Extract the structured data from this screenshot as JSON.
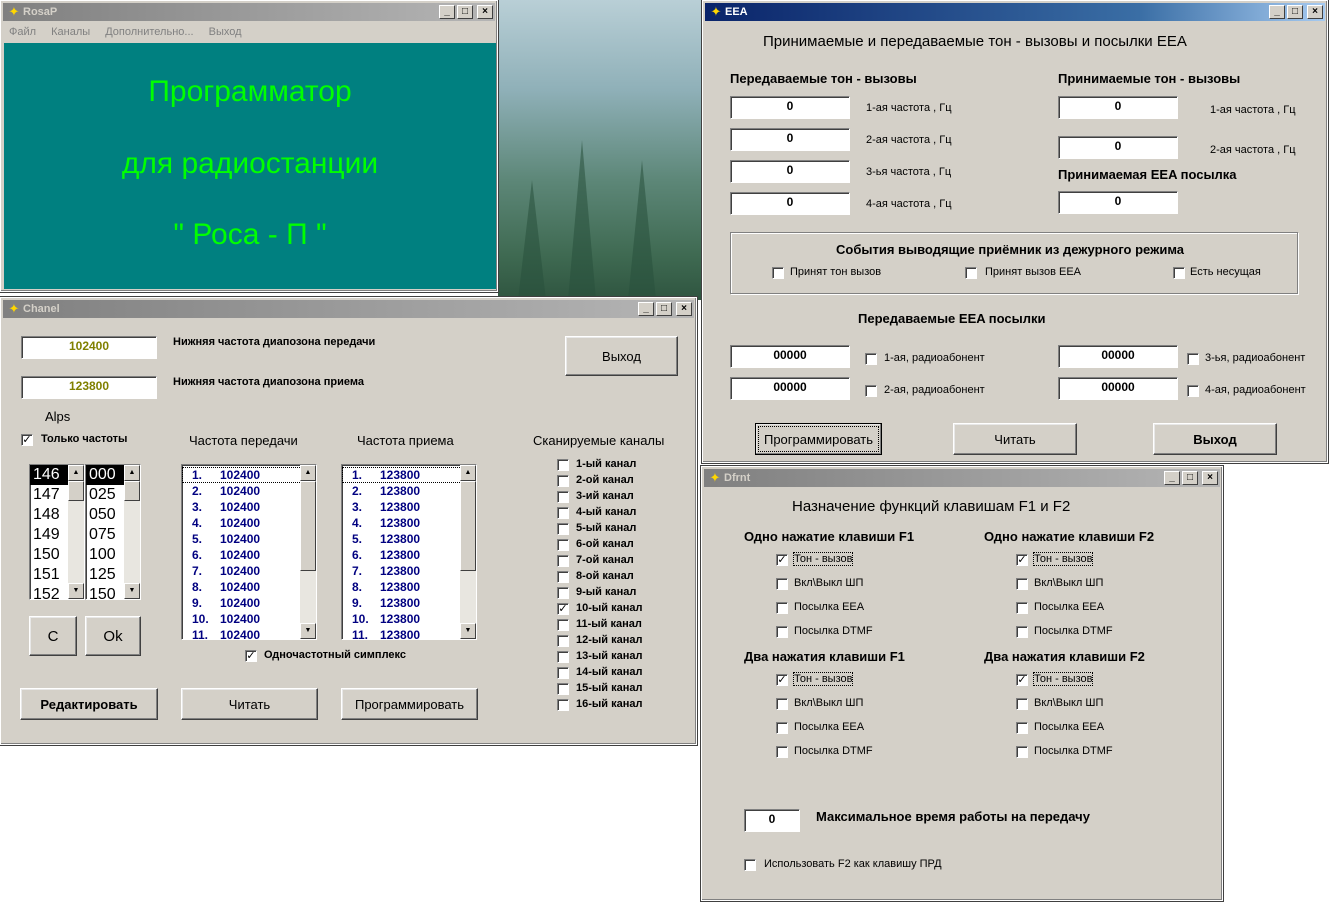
{
  "rosap": {
    "title": "RosaP",
    "menu": [
      "Файл",
      "Каналы",
      "Дополнительно...",
      "Выход"
    ],
    "banner": [
      "Программатор",
      "для  радиостанции",
      "\" Роса -  П \""
    ]
  },
  "chanel": {
    "title": "Chanel",
    "tx_low_value": "102400",
    "tx_low_label": "Нижняя  частота  диапозона  передачи",
    "rx_low_value": "123800",
    "rx_low_label": "Нижняя  частота  диапозона  приема",
    "exit_label": "Выход",
    "alps_label": "Alps",
    "only_freq_label": "Только частоты",
    "tx_freq_header": "Частота передачи",
    "rx_freq_header": "Частота приема",
    "scan_header": "Сканируемые  каналы",
    "mhz_list": [
      "146",
      "147",
      "148",
      "149",
      "150",
      "151",
      "152"
    ],
    "khz_list": [
      "000",
      "025",
      "050",
      "075",
      "100",
      "125",
      "150"
    ],
    "tx_list": [
      {
        "n": "1.",
        "v": "102400"
      },
      {
        "n": "2.",
        "v": "102400"
      },
      {
        "n": "3.",
        "v": "102400"
      },
      {
        "n": "4.",
        "v": "102400"
      },
      {
        "n": "5.",
        "v": "102400"
      },
      {
        "n": "6.",
        "v": "102400"
      },
      {
        "n": "7.",
        "v": "102400"
      },
      {
        "n": "8.",
        "v": "102400"
      },
      {
        "n": "9.",
        "v": "102400"
      },
      {
        "n": "10.",
        "v": "102400"
      },
      {
        "n": "11.",
        "v": "102400"
      }
    ],
    "rx_list": [
      {
        "n": "1.",
        "v": "123800"
      },
      {
        "n": "2.",
        "v": "123800"
      },
      {
        "n": "3.",
        "v": "123800"
      },
      {
        "n": "4.",
        "v": "123800"
      },
      {
        "n": "5.",
        "v": "123800"
      },
      {
        "n": "6.",
        "v": "123800"
      },
      {
        "n": "7.",
        "v": "123800"
      },
      {
        "n": "8.",
        "v": "123800"
      },
      {
        "n": "9.",
        "v": "123800"
      },
      {
        "n": "10.",
        "v": "123800"
      },
      {
        "n": "11.",
        "v": "123800"
      }
    ],
    "scan_channels": [
      {
        "label": "1-ый канал",
        "checked": false
      },
      {
        "label": "2-ой канал",
        "checked": false
      },
      {
        "label": "3-ий канал",
        "checked": false
      },
      {
        "label": "4-ый канал",
        "checked": false
      },
      {
        "label": "5-ый канал",
        "checked": false
      },
      {
        "label": "6-ой канал",
        "checked": false
      },
      {
        "label": "7-ой канал",
        "checked": false
      },
      {
        "label": "8-ой канал",
        "checked": false
      },
      {
        "label": "9-ый канал",
        "checked": false
      },
      {
        "label": "10-ый канал",
        "checked": true
      },
      {
        "label": "11-ый канал",
        "checked": false
      },
      {
        "label": "12-ый канал",
        "checked": false
      },
      {
        "label": "13-ый канал",
        "checked": false
      },
      {
        "label": "14-ый канал",
        "checked": false
      },
      {
        "label": "15-ый канал",
        "checked": false
      },
      {
        "label": "16-ый канал",
        "checked": false
      }
    ],
    "c_label": "C",
    "ok_label": "Ok",
    "simplex_label": "Одночастотный симплекс",
    "edit_label": "Редактировать",
    "read_label": "Читать",
    "program_label": "Программировать"
  },
  "eea": {
    "title": "EEA",
    "heading": "Принимаемые и передаваемые тон - вызовы и посылки EEA",
    "tx_tones_header": "Передаваемые тон - вызовы",
    "rx_tones_header": "Принимаемые тон - вызовы",
    "tx_tones": [
      {
        "value": "0",
        "label": "1-ая частота , Гц"
      },
      {
        "value": "0",
        "label": "2-ая  частота , Гц"
      },
      {
        "value": "0",
        "label": "3-ья частота , Гц"
      },
      {
        "value": "0",
        "label": "4-ая частота , Гц"
      }
    ],
    "rx_tones": [
      {
        "value": "0",
        "label": "1-ая частота , Гц"
      },
      {
        "value": "0",
        "label": "2-ая  частота , Гц"
      }
    ],
    "rx_eea_header": "Принимаемая EEA посылка",
    "rx_eea_value": "0",
    "events_header": "События выводящие приёмник из дежурного режима",
    "events": [
      "Принят тон вызов",
      "Принят вызов EEA",
      "Есть несущая"
    ],
    "tx_eea_header": "Передаваемые EEA посылки",
    "tx_eea": [
      {
        "value": "00000",
        "label": "1-ая, радиоабонент"
      },
      {
        "value": "00000",
        "label": "2-ая, радиоабонент"
      },
      {
        "value": "00000",
        "label": "3-ья, радиоабонент"
      },
      {
        "value": "00000",
        "label": "4-ая, радиоабонент"
      }
    ],
    "program_label": "Программировать",
    "read_label": "Читать",
    "exit_label": "Выход"
  },
  "dfrnt": {
    "title": "Dfrnt",
    "heading": "Назначение функций клавишам F1 и F2",
    "groups": [
      {
        "title": "Одно нажатие клавиши  F1",
        "options": [
          "Тон - вызов",
          "Вкл\\Выкл ШП",
          "Посылка EEA",
          "Посылка DTMF"
        ],
        "checked": 0
      },
      {
        "title": "Одно нажатие клавиши F2",
        "options": [
          "Тон - вызов",
          "Вкл\\Выкл ШП",
          "Посылка EEA",
          "Посылка DTMF"
        ],
        "checked": 0
      },
      {
        "title": "Два нажатия клавиши  F1",
        "options": [
          "Тон - вызов",
          "Вкл\\Выкл ШП",
          "Посылка EEA",
          "Посылка DTMF"
        ],
        "checked": 0
      },
      {
        "title": "Два нажатия клавиши  F2",
        "options": [
          "Тон - вызов",
          "Вкл\\Выкл ШП",
          "Посылка EEA",
          "Посылка DTMF"
        ],
        "checked": 0
      }
    ],
    "max_tx_value": "0",
    "max_tx_label": "Максимальное время работы на передачу",
    "f2_ptt_label": "Использовать F2 как клавишу ПРД"
  },
  "colors": {
    "teal": "#008080",
    "banner_text": "#00ff00",
    "freq_text": "#808000",
    "list_text": "#000080"
  }
}
